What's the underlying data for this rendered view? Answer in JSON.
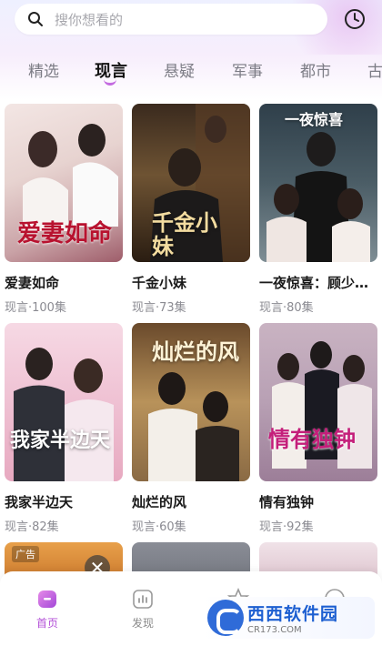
{
  "search": {
    "placeholder": "搜你想看的"
  },
  "tabs": [
    {
      "label": "精选"
    },
    {
      "label": "现言"
    },
    {
      "label": "悬疑"
    },
    {
      "label": "军事"
    },
    {
      "label": "都市"
    },
    {
      "label": "古"
    }
  ],
  "cards": [
    {
      "poster_text": "爱妻如命",
      "title": "爱妻如命",
      "meta": "现言·100集"
    },
    {
      "poster_text": "千金小妹",
      "title": "千金小妹",
      "meta": "现言·73集"
    },
    {
      "poster_text": "一夜惊喜",
      "title": "一夜惊喜：顾少…",
      "meta": "现言·80集"
    },
    {
      "poster_text": "我家半边天",
      "title": "我家半边天",
      "meta": "现言·82集"
    },
    {
      "poster_text": "灿烂的风",
      "title": "灿烂的风",
      "meta": "现言·60集"
    },
    {
      "poster_text": "情有独钟",
      "title": "情有独钟",
      "meta": "现言·92集"
    }
  ],
  "ad": {
    "tag": "广告",
    "close": "✕"
  },
  "nav": [
    {
      "label": "首页"
    },
    {
      "label": "发现"
    }
  ],
  "watermark": {
    "main": "西西软件园",
    "sub": "CR173.COM"
  },
  "colors": {
    "accent": "#c46be0",
    "nav_active": "#b453d8"
  }
}
